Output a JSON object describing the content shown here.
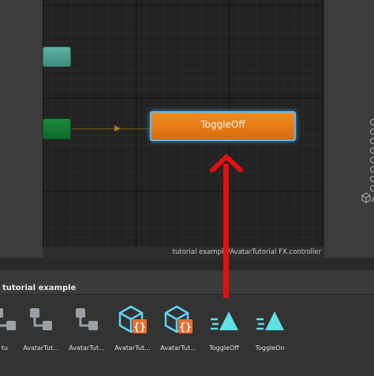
{
  "graph": {
    "states": {
      "toggle_off": "ToggleOff"
    },
    "path": "tutorial example/AvatarTutorial FX.controller"
  },
  "project": {
    "breadcrumb": "tutorial example",
    "assets": [
      {
        "label": "tu",
        "icon": "animator-controller-icon"
      },
      {
        "label": "AvatarTut...",
        "icon": "animator-controller-icon"
      },
      {
        "label": "AvatarTut...",
        "icon": "animator-controller-icon"
      },
      {
        "label": "AvatarTut...",
        "icon": "scriptable-object-icon"
      },
      {
        "label": "AvatarTut...",
        "icon": "scriptable-object-icon"
      },
      {
        "label": "ToggleOff",
        "icon": "animation-clip-icon"
      },
      {
        "label": "ToggleOn",
        "icon": "animation-clip-icon"
      }
    ]
  },
  "right_panel": {
    "label": "A"
  },
  "colors": {
    "state_orange": "#e0780f",
    "selection_outline": "#5fb8f0",
    "annotation_arrow": "#e60f0f",
    "asset_icon_cyan": "#5fd4f0"
  }
}
